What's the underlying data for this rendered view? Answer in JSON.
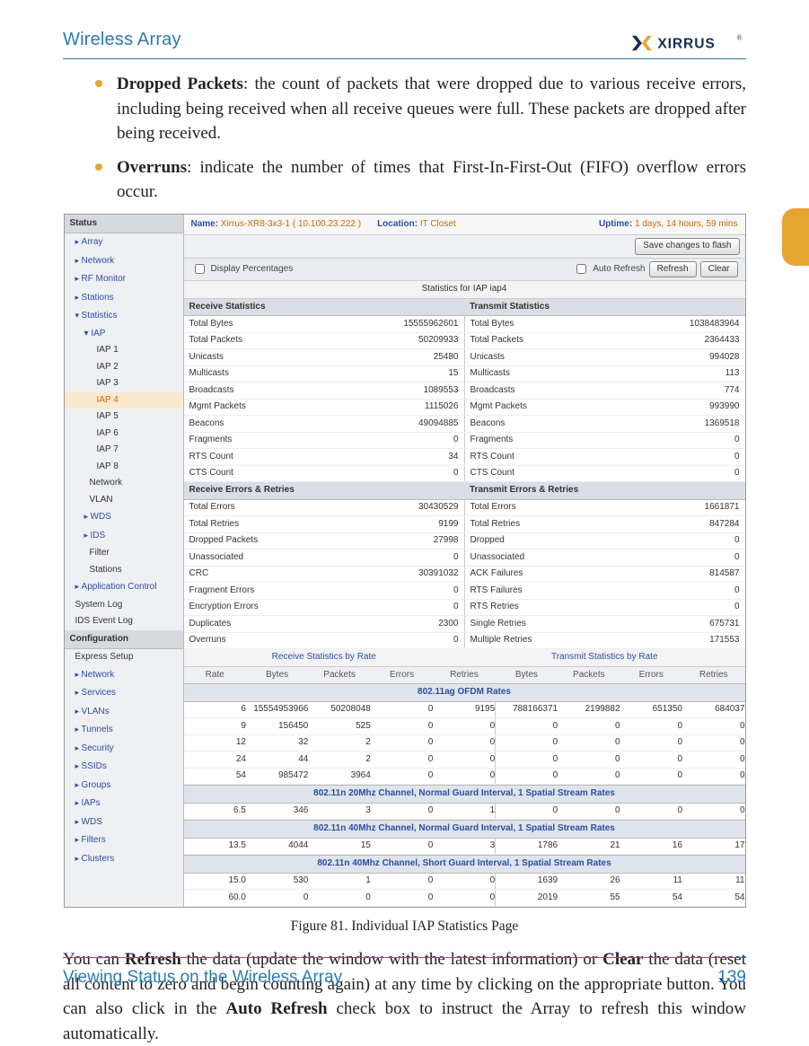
{
  "header": {
    "left": "Wireless Array",
    "logo_text": "XIRRUS"
  },
  "bullets": [
    {
      "bold": "Dropped Packets",
      "rest": ": the count of packets that were dropped due to various receive errors, including being received when all receive queues were full. These packets are dropped after being received."
    },
    {
      "bold": "Overruns",
      "rest": ": indicate the number of times that First-In-First-Out (FIFO) overflow errors occur."
    }
  ],
  "figure_caption": "Figure 81. Individual IAP Statistics Page",
  "paragraph_parts": {
    "p1": "You can ",
    "b1": "Refresh",
    "p2": " the data (update the window with the latest information) or ",
    "b2": "Clear",
    "p3": " the data (reset all content to zero and begin counting again) at any time by clicking on the appropriate button. You can also click in the ",
    "b3": "Auto Refresh",
    "p4": " check box to instruct the Array to refresh this window automatically."
  },
  "footer": {
    "left": "Viewing Status on the Wireless Array",
    "right": "139"
  },
  "shot": {
    "nav": {
      "status_label": "Status",
      "top": [
        "Array",
        "Network",
        "RF Monitor",
        "Stations"
      ],
      "stats_label": "Statistics",
      "iap_label": "IAP",
      "iaps": [
        "IAP 1",
        "IAP 2",
        "IAP 3",
        "IAP 4",
        "IAP 5",
        "IAP 6",
        "IAP 7",
        "IAP 8"
      ],
      "selected_iap_index": 3,
      "after_iaps": [
        "Network",
        "VLAN"
      ],
      "wds": "WDS",
      "ids": "IDS",
      "after_ids": [
        "Filter",
        "Stations"
      ],
      "app_control": "Application Control",
      "syslog": "System Log",
      "idslog": "IDS Event Log",
      "config_label": "Configuration",
      "express": "Express Setup",
      "config": [
        "Network",
        "Services",
        "VLANs",
        "Tunnels",
        "Security",
        "SSIDs",
        "Groups",
        "IAPs",
        "WDS",
        "Filters",
        "Clusters"
      ]
    },
    "info": {
      "name_label": "Name:",
      "name": "Xirrus-XR8-3x3-1",
      "ip": "( 10.100.23.222 )",
      "location_label": "Location:",
      "location": "IT Closet",
      "uptime_label": "Uptime:",
      "uptime": "1 days, 14 hours, 59 mins"
    },
    "buttons": {
      "save": "Save changes to flash",
      "refresh": "Refresh",
      "clear": "Clear"
    },
    "checks": {
      "display_pct": "Display Percentages",
      "auto_refresh": "Auto Refresh"
    },
    "caption": "Statistics for IAP iap4",
    "rx_header": "Receive Statistics",
    "tx_header": "Transmit Statistics",
    "rows": [
      {
        "l": "Total Bytes",
        "lv": "15555962601",
        "r": "Total Bytes",
        "rv": "1038483964"
      },
      {
        "l": "Total Packets",
        "lv": "50209933",
        "r": "Total Packets",
        "rv": "2364433"
      },
      {
        "l": "Unicasts",
        "lv": "25480",
        "r": "Unicasts",
        "rv": "994028"
      },
      {
        "l": "Multicasts",
        "lv": "15",
        "r": "Multicasts",
        "rv": "113"
      },
      {
        "l": "Broadcasts",
        "lv": "1089553",
        "r": "Broadcasts",
        "rv": "774"
      },
      {
        "l": "Mgmt Packets",
        "lv": "1115026",
        "r": "Mgmt Packets",
        "rv": "993990"
      },
      {
        "l": "Beacons",
        "lv": "49094885",
        "r": "Beacons",
        "rv": "1369518"
      },
      {
        "l": "Fragments",
        "lv": "0",
        "r": "Fragments",
        "rv": "0"
      },
      {
        "l": "RTS Count",
        "lv": "34",
        "r": "RTS Count",
        "rv": "0"
      },
      {
        "l": "CTS Count",
        "lv": "0",
        "r": "CTS Count",
        "rv": "0"
      }
    ],
    "err_rx_header": "Receive Errors & Retries",
    "err_tx_header": "Transmit Errors & Retries",
    "err_rows": [
      {
        "l": "Total Errors",
        "lv": "30430529",
        "r": "Total Errors",
        "rv": "1661871"
      },
      {
        "l": "Total Retries",
        "lv": "9199",
        "r": "Total Retries",
        "rv": "847284"
      },
      {
        "l": "Dropped Packets",
        "lv": "27998",
        "r": "Dropped",
        "rv": "0"
      },
      {
        "l": "Unassociated",
        "lv": "0",
        "r": "Unassociated",
        "rv": "0"
      },
      {
        "l": "CRC",
        "lv": "30391032",
        "r": "ACK Failures",
        "rv": "814587"
      },
      {
        "l": "Fragment Errors",
        "lv": "0",
        "r": "RTS Failures",
        "rv": "0"
      },
      {
        "l": "Encryption Errors",
        "lv": "0",
        "r": "RTS Retries",
        "rv": "0"
      },
      {
        "l": "Duplicates",
        "lv": "2300",
        "r": "Single Retries",
        "rv": "675731"
      },
      {
        "l": "Overruns",
        "lv": "0",
        "r": "Multiple Retries",
        "rv": "171553"
      }
    ],
    "rate_super_rx": "Receive Statistics by Rate",
    "rate_super_tx": "Transmit Statistics by Rate",
    "rate_cols": [
      "Rate",
      "Bytes",
      "Packets",
      "Errors",
      "Retries",
      "Bytes",
      "Packets",
      "Errors",
      "Retries"
    ],
    "bands": [
      {
        "title": "802.11ag OFDM Rates",
        "rows": [
          [
            "6",
            "15554953966",
            "50208048",
            "0",
            "9195",
            "788166371",
            "2199882",
            "651350",
            "684037"
          ],
          [
            "9",
            "156450",
            "525",
            "0",
            "0",
            "0",
            "0",
            "0",
            "0"
          ],
          [
            "12",
            "32",
            "2",
            "0",
            "0",
            "0",
            "0",
            "0",
            "0"
          ],
          [
            "24",
            "44",
            "2",
            "0",
            "0",
            "0",
            "0",
            "0",
            "0"
          ],
          [
            "54",
            "985472",
            "3964",
            "0",
            "0",
            "0",
            "0",
            "0",
            "0"
          ]
        ]
      },
      {
        "title": "802.11n 20Mhz Channel, Normal Guard Interval, 1 Spatial Stream Rates",
        "rows": [
          [
            "6.5",
            "346",
            "3",
            "0",
            "1",
            "0",
            "0",
            "0",
            "0"
          ]
        ]
      },
      {
        "title": "802.11n 40Mhz Channel, Normal Guard Interval, 1 Spatial Stream Rates",
        "rows": [
          [
            "13.5",
            "4044",
            "15",
            "0",
            "3",
            "1786",
            "21",
            "16",
            "17"
          ]
        ]
      },
      {
        "title": "802.11n 40Mhz Channel, Short Guard Interval, 1 Spatial Stream Rates",
        "rows": [
          [
            "15.0",
            "530",
            "1",
            "0",
            "0",
            "1639",
            "26",
            "11",
            "11"
          ],
          [
            "60.0",
            "0",
            "0",
            "0",
            "0",
            "2019",
            "55",
            "54",
            "54"
          ]
        ]
      }
    ]
  }
}
